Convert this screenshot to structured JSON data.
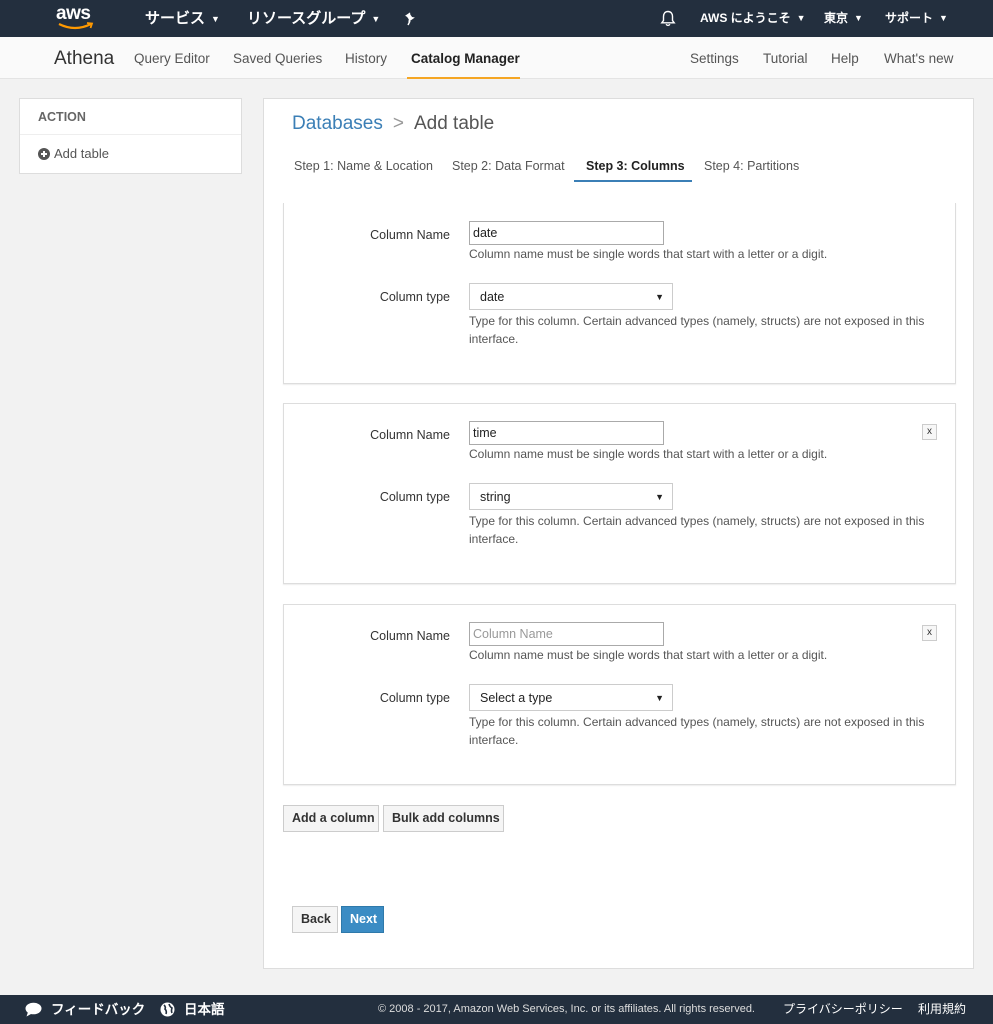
{
  "topbar": {
    "logo": "aws",
    "services": "サービス",
    "resource_groups": "リソースグループ",
    "pin_icon": "pin-icon",
    "bell_icon": "bell-icon",
    "account": "AWS にようこそ",
    "region": "東京",
    "support": "サポート"
  },
  "subnav": {
    "brand": "Athena",
    "links": [
      "Query Editor",
      "Saved Queries",
      "History",
      "Catalog Manager"
    ],
    "right_links": [
      "Settings",
      "Tutorial",
      "Help",
      "What's new"
    ],
    "active": "Catalog Manager",
    "accent_color": "#f5a623"
  },
  "sidebar": {
    "heading": "ACTION",
    "item": "Add table"
  },
  "main": {
    "breadcrumb": {
      "parent": "Databases",
      "separator": ">",
      "current": "Add table"
    },
    "steps": [
      "Step 1: Name & Location",
      "Step 2: Data Format",
      "Step 3: Columns",
      "Step 4: Partitions"
    ],
    "active_step": "Step 3: Columns",
    "columns": [
      {
        "name_label": "Column Name",
        "name_value": "date",
        "name_placeholder": "Column Name",
        "name_help": "Column name must be single words that start with a letter or a digit.",
        "type_label": "Column type",
        "type_value": "date",
        "type_help": "Type for this column. Certain advanced types (namely, structs) are not exposed in this interface.",
        "removable": false
      },
      {
        "name_label": "Column Name",
        "name_value": "time",
        "name_placeholder": "Column Name",
        "name_help": "Column name must be single words that start with a letter or a digit.",
        "type_label": "Column type",
        "type_value": "string",
        "type_help": "Type for this column. Certain advanced types (namely, structs) are not exposed in this interface.",
        "removable": true
      },
      {
        "name_label": "Column Name",
        "name_value": "",
        "name_placeholder": "Column Name",
        "name_help": "Column name must be single words that start with a letter or a digit.",
        "type_label": "Column type",
        "type_value": "Select a type",
        "type_help": "Type for this column. Certain advanced types (namely, structs) are not exposed in this interface.",
        "removable": true
      }
    ],
    "remove_label": "x",
    "add_column": "Add a column",
    "bulk_add": "Bulk add columns",
    "back": "Back",
    "next": "Next",
    "link_color": "#3b7fb6",
    "primary_color": "#3b8cc4"
  },
  "footer": {
    "feedback": "フィードバック",
    "language": "日本語",
    "copyright": "© 2008 - 2017, Amazon Web Services, Inc. or its affiliates. All rights reserved.",
    "privacy": "プライバシーポリシー",
    "terms": "利用規約"
  }
}
